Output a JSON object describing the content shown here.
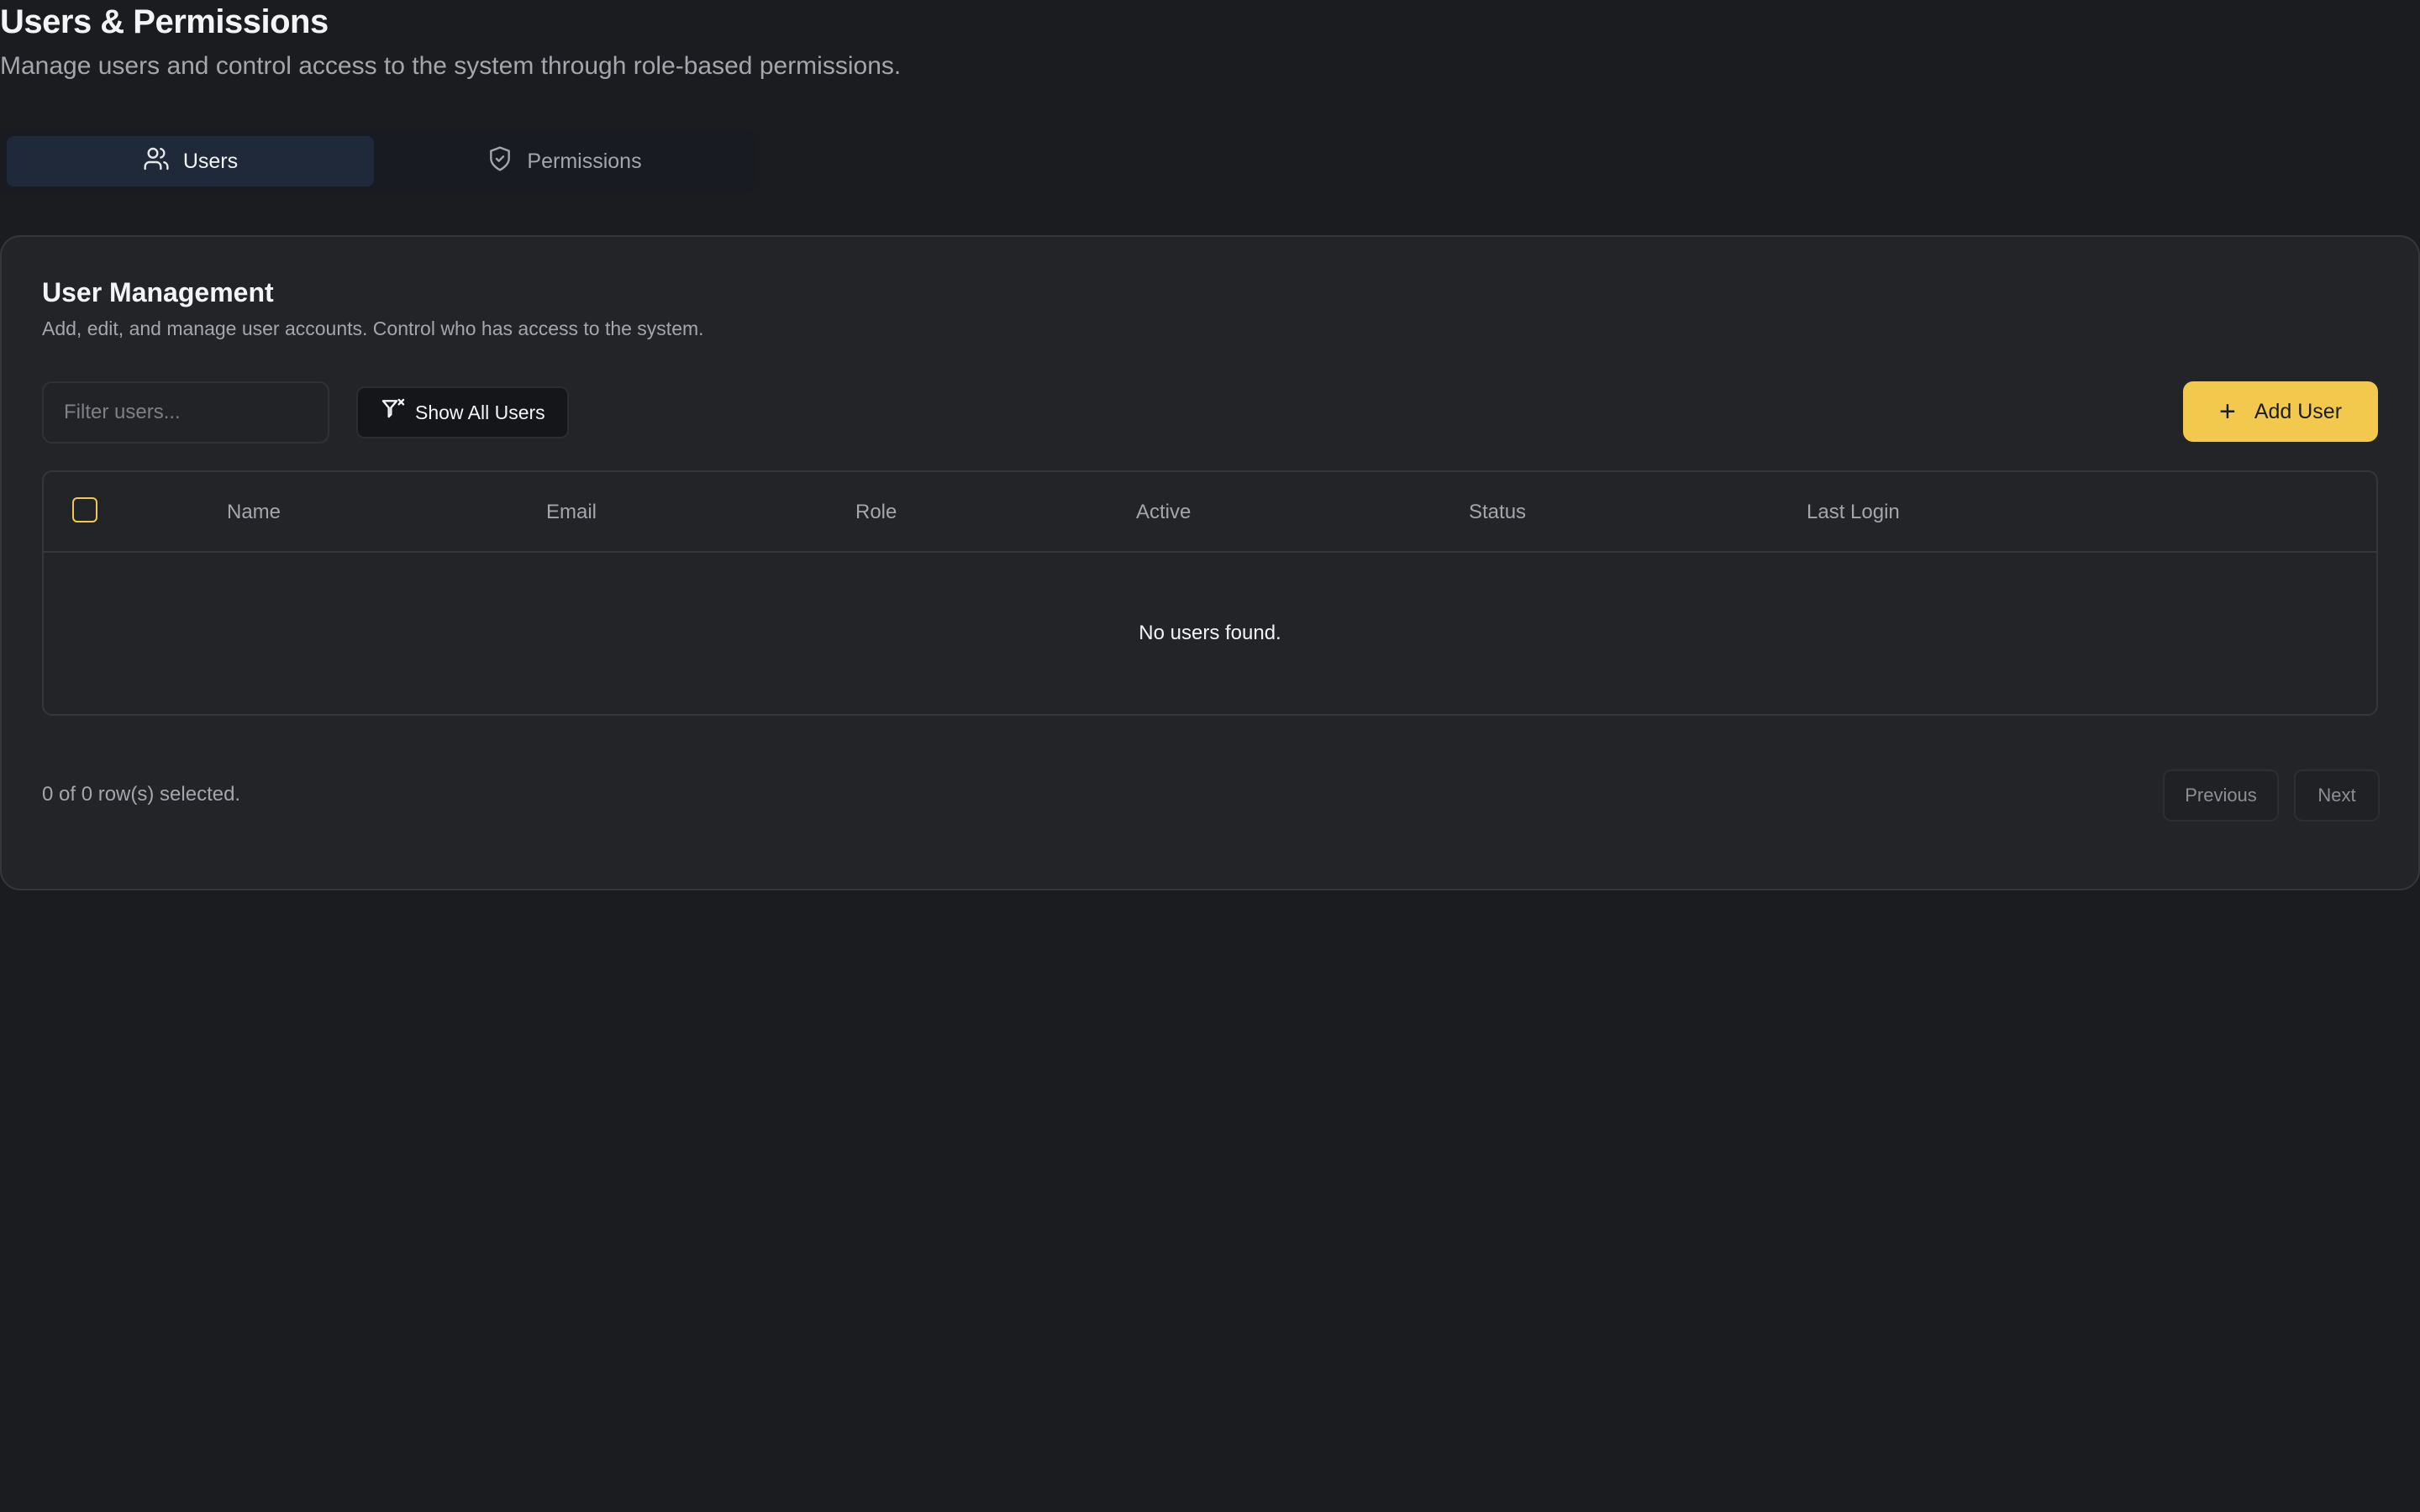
{
  "header": {
    "title": "Users & Permissions",
    "subtitle": "Manage users and control access to the system through role-based permissions."
  },
  "tabs": [
    {
      "label": "Users",
      "icon": "users-icon",
      "active": true
    },
    {
      "label": "Permissions",
      "icon": "shield-check-icon",
      "active": false
    }
  ],
  "card": {
    "title": "User Management",
    "description": "Add, edit, and manage user accounts. Control who has access to the system."
  },
  "toolbar": {
    "filter_placeholder": "Filter users...",
    "filter_value": "",
    "show_all_label": "Show All Users",
    "show_all_icon": "filter-x-icon",
    "add_user_label": "Add User",
    "add_user_icon": "plus-icon"
  },
  "table": {
    "columns": [
      "Name",
      "Email",
      "Role",
      "Active",
      "Status",
      "Last Login"
    ],
    "rows": [],
    "empty_message": "No users found."
  },
  "footer": {
    "selection_status": "0 of 0 row(s) selected.",
    "previous_label": "Previous",
    "next_label": "Next"
  },
  "colors": {
    "background": "#1b1c20",
    "card": "#232428",
    "accent": "#f2c94c",
    "active_tab": "#1f2939"
  }
}
